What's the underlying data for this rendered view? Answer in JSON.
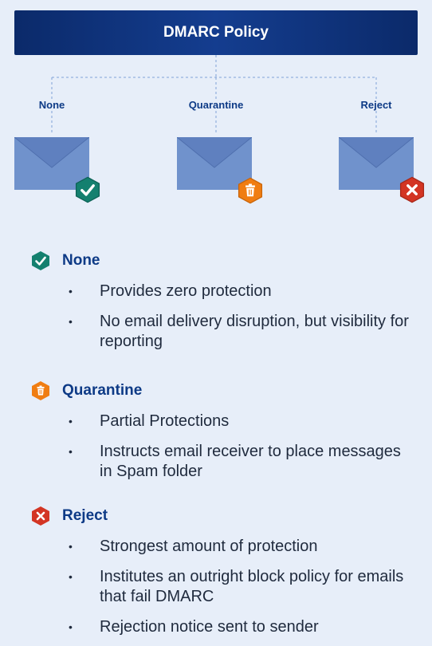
{
  "header": {
    "title": "DMARC Policy"
  },
  "branches": [
    {
      "label": "None",
      "badge": "check-icon"
    },
    {
      "label": "Quarantine",
      "badge": "trash-icon"
    },
    {
      "label": "Reject",
      "badge": "x-icon"
    }
  ],
  "sections": [
    {
      "title": "None",
      "icon": "check-icon",
      "bullets": [
        "Provides zero protection",
        "No email delivery disruption, but visibility for reporting"
      ]
    },
    {
      "title": "Quarantine",
      "icon": "trash-icon",
      "bullets": [
        "Partial Protections",
        "Instructs email receiver to place messages in Spam folder"
      ]
    },
    {
      "title": "Reject",
      "icon": "x-icon",
      "bullets": [
        "Strongest amount of protection",
        "Institutes an outright block policy for emails that fail DMARC",
        "Rejection notice sent to sender"
      ]
    }
  ],
  "colors": {
    "header": "#0b2a6a",
    "accent_text": "#0d3a86",
    "envelope": "#6f8fcb",
    "none_badge": "#14806f",
    "quarantine_badge": "#f07d12",
    "reject_badge": "#d33524"
  }
}
